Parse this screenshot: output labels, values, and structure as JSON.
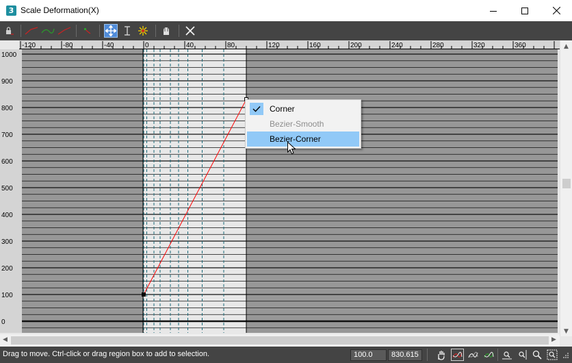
{
  "window": {
    "title": "Scale Deformation(X)",
    "app_icon_glyph": "3"
  },
  "toolbar": {
    "tools": [
      "lock-icon",
      "insert-corner-point-icon",
      "insert-bezier-point-icon",
      "delete-point-icon",
      "move-control-point-icon",
      "scale-control-point-icon",
      "insert-point-icon",
      "reset-curve-icon",
      "delete-control-point-icon"
    ]
  },
  "graph": {
    "x_ticks": [
      "-120",
      "-80",
      "-40",
      "0",
      "40",
      "80",
      "120",
      "160",
      "200",
      "240",
      "280",
      "320",
      "360"
    ],
    "y_ticks": [
      "1000",
      "900",
      "800",
      "700",
      "600",
      "500",
      "400",
      "300",
      "200",
      "100",
      "0"
    ],
    "curve_color": "#ff0000",
    "control_point_1": {
      "x": 0,
      "y": 100
    },
    "control_point_2": {
      "x": 100,
      "y": 830.615
    }
  },
  "context_menu": {
    "items": [
      {
        "label": "Corner",
        "checked": true,
        "enabled": true
      },
      {
        "label": "Bezier-Smooth",
        "checked": false,
        "enabled": false
      },
      {
        "label": "Bezier-Corner",
        "checked": false,
        "enabled": true,
        "highlighted": true
      }
    ]
  },
  "status": {
    "hint": "Drag to move. Ctrl-click or drag region box to add to selection.",
    "x_value": "100.0",
    "y_value": "830.615"
  },
  "colors": {
    "toolbar_bg": "#444444",
    "plot_bg": "#979797",
    "selection_band": "#e8e8e8",
    "menu_highlight": "#91c9f7"
  }
}
